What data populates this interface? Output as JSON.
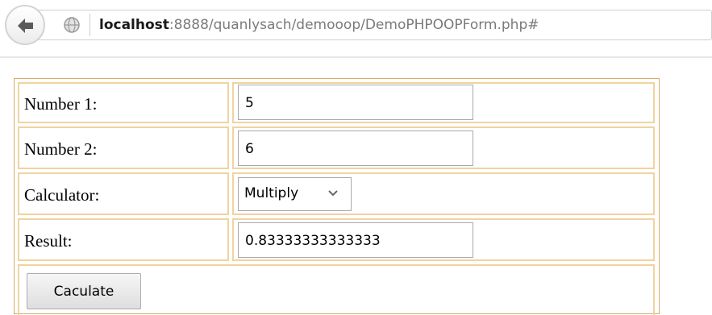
{
  "browser": {
    "url_host": "localhost",
    "url_path": ":8888/quanlysach/demooop/DemoPHPOOPForm.php#"
  },
  "form": {
    "number1": {
      "label": "Number 1:",
      "value": "5"
    },
    "number2": {
      "label": "Number 2:",
      "value": "6"
    },
    "calculator": {
      "label": "Calculator:",
      "selected": "Multiply"
    },
    "result": {
      "label": "Result:",
      "value": "0.83333333333333"
    },
    "submit_label": "Caculate"
  },
  "icons": {
    "back": "back-arrow-icon",
    "site": "globe-icon",
    "select": "chevron-down-icon"
  },
  "colors": {
    "table_border": "#d7ad66",
    "cell_border": "#f0d3a0"
  }
}
